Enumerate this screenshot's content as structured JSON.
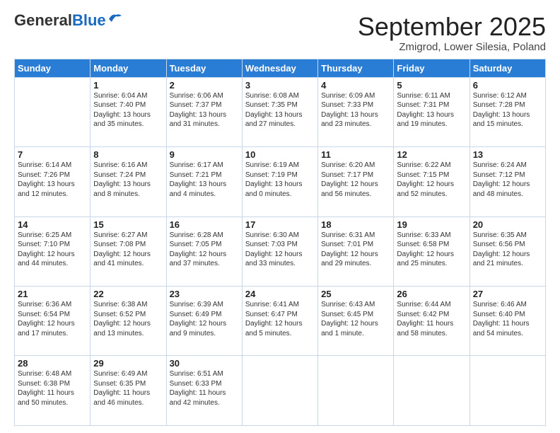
{
  "logo": {
    "line1a": "General",
    "line1b": "Blue"
  },
  "header": {
    "month": "September 2025",
    "location": "Zmigrod, Lower Silesia, Poland"
  },
  "weekdays": [
    "Sunday",
    "Monday",
    "Tuesday",
    "Wednesday",
    "Thursday",
    "Friday",
    "Saturday"
  ],
  "weeks": [
    [
      {
        "day": "",
        "info": ""
      },
      {
        "day": "1",
        "info": "Sunrise: 6:04 AM\nSunset: 7:40 PM\nDaylight: 13 hours\nand 35 minutes."
      },
      {
        "day": "2",
        "info": "Sunrise: 6:06 AM\nSunset: 7:37 PM\nDaylight: 13 hours\nand 31 minutes."
      },
      {
        "day": "3",
        "info": "Sunrise: 6:08 AM\nSunset: 7:35 PM\nDaylight: 13 hours\nand 27 minutes."
      },
      {
        "day": "4",
        "info": "Sunrise: 6:09 AM\nSunset: 7:33 PM\nDaylight: 13 hours\nand 23 minutes."
      },
      {
        "day": "5",
        "info": "Sunrise: 6:11 AM\nSunset: 7:31 PM\nDaylight: 13 hours\nand 19 minutes."
      },
      {
        "day": "6",
        "info": "Sunrise: 6:12 AM\nSunset: 7:28 PM\nDaylight: 13 hours\nand 15 minutes."
      }
    ],
    [
      {
        "day": "7",
        "info": "Sunrise: 6:14 AM\nSunset: 7:26 PM\nDaylight: 13 hours\nand 12 minutes."
      },
      {
        "day": "8",
        "info": "Sunrise: 6:16 AM\nSunset: 7:24 PM\nDaylight: 13 hours\nand 8 minutes."
      },
      {
        "day": "9",
        "info": "Sunrise: 6:17 AM\nSunset: 7:21 PM\nDaylight: 13 hours\nand 4 minutes."
      },
      {
        "day": "10",
        "info": "Sunrise: 6:19 AM\nSunset: 7:19 PM\nDaylight: 13 hours\nand 0 minutes."
      },
      {
        "day": "11",
        "info": "Sunrise: 6:20 AM\nSunset: 7:17 PM\nDaylight: 12 hours\nand 56 minutes."
      },
      {
        "day": "12",
        "info": "Sunrise: 6:22 AM\nSunset: 7:15 PM\nDaylight: 12 hours\nand 52 minutes."
      },
      {
        "day": "13",
        "info": "Sunrise: 6:24 AM\nSunset: 7:12 PM\nDaylight: 12 hours\nand 48 minutes."
      }
    ],
    [
      {
        "day": "14",
        "info": "Sunrise: 6:25 AM\nSunset: 7:10 PM\nDaylight: 12 hours\nand 44 minutes."
      },
      {
        "day": "15",
        "info": "Sunrise: 6:27 AM\nSunset: 7:08 PM\nDaylight: 12 hours\nand 41 minutes."
      },
      {
        "day": "16",
        "info": "Sunrise: 6:28 AM\nSunset: 7:05 PM\nDaylight: 12 hours\nand 37 minutes."
      },
      {
        "day": "17",
        "info": "Sunrise: 6:30 AM\nSunset: 7:03 PM\nDaylight: 12 hours\nand 33 minutes."
      },
      {
        "day": "18",
        "info": "Sunrise: 6:31 AM\nSunset: 7:01 PM\nDaylight: 12 hours\nand 29 minutes."
      },
      {
        "day": "19",
        "info": "Sunrise: 6:33 AM\nSunset: 6:58 PM\nDaylight: 12 hours\nand 25 minutes."
      },
      {
        "day": "20",
        "info": "Sunrise: 6:35 AM\nSunset: 6:56 PM\nDaylight: 12 hours\nand 21 minutes."
      }
    ],
    [
      {
        "day": "21",
        "info": "Sunrise: 6:36 AM\nSunset: 6:54 PM\nDaylight: 12 hours\nand 17 minutes."
      },
      {
        "day": "22",
        "info": "Sunrise: 6:38 AM\nSunset: 6:52 PM\nDaylight: 12 hours\nand 13 minutes."
      },
      {
        "day": "23",
        "info": "Sunrise: 6:39 AM\nSunset: 6:49 PM\nDaylight: 12 hours\nand 9 minutes."
      },
      {
        "day": "24",
        "info": "Sunrise: 6:41 AM\nSunset: 6:47 PM\nDaylight: 12 hours\nand 5 minutes."
      },
      {
        "day": "25",
        "info": "Sunrise: 6:43 AM\nSunset: 6:45 PM\nDaylight: 12 hours\nand 1 minute."
      },
      {
        "day": "26",
        "info": "Sunrise: 6:44 AM\nSunset: 6:42 PM\nDaylight: 11 hours\nand 58 minutes."
      },
      {
        "day": "27",
        "info": "Sunrise: 6:46 AM\nSunset: 6:40 PM\nDaylight: 11 hours\nand 54 minutes."
      }
    ],
    [
      {
        "day": "28",
        "info": "Sunrise: 6:48 AM\nSunset: 6:38 PM\nDaylight: 11 hours\nand 50 minutes."
      },
      {
        "day": "29",
        "info": "Sunrise: 6:49 AM\nSunset: 6:35 PM\nDaylight: 11 hours\nand 46 minutes."
      },
      {
        "day": "30",
        "info": "Sunrise: 6:51 AM\nSunset: 6:33 PM\nDaylight: 11 hours\nand 42 minutes."
      },
      {
        "day": "",
        "info": ""
      },
      {
        "day": "",
        "info": ""
      },
      {
        "day": "",
        "info": ""
      },
      {
        "day": "",
        "info": ""
      }
    ]
  ]
}
